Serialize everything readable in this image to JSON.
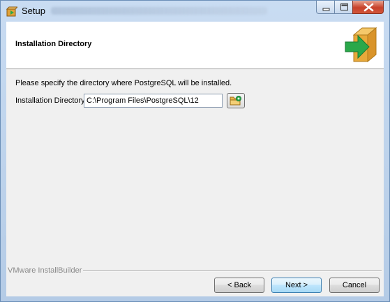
{
  "window": {
    "title": "Setup",
    "controls": {
      "minimize": "minimize",
      "maximize": "maximize",
      "close": "close"
    }
  },
  "header": {
    "title": "Installation Directory",
    "icon": "green-arrow-into-box-icon"
  },
  "content": {
    "description": "Please specify the directory where PostgreSQL will be installed.",
    "dir_label": "Installation Directory",
    "dir_value": "C:\\Program Files\\PostgreSQL\\12",
    "browse_icon": "folder-browse-icon"
  },
  "footer": {
    "brand": "VMware InstallBuilder",
    "back": "< Back",
    "next": "Next >",
    "cancel": "Cancel"
  },
  "colors": {
    "frame": "#b4cbe6",
    "close": "#c7412a",
    "accent_green": "#2aa84a",
    "box_orange": "#e8a93a"
  }
}
